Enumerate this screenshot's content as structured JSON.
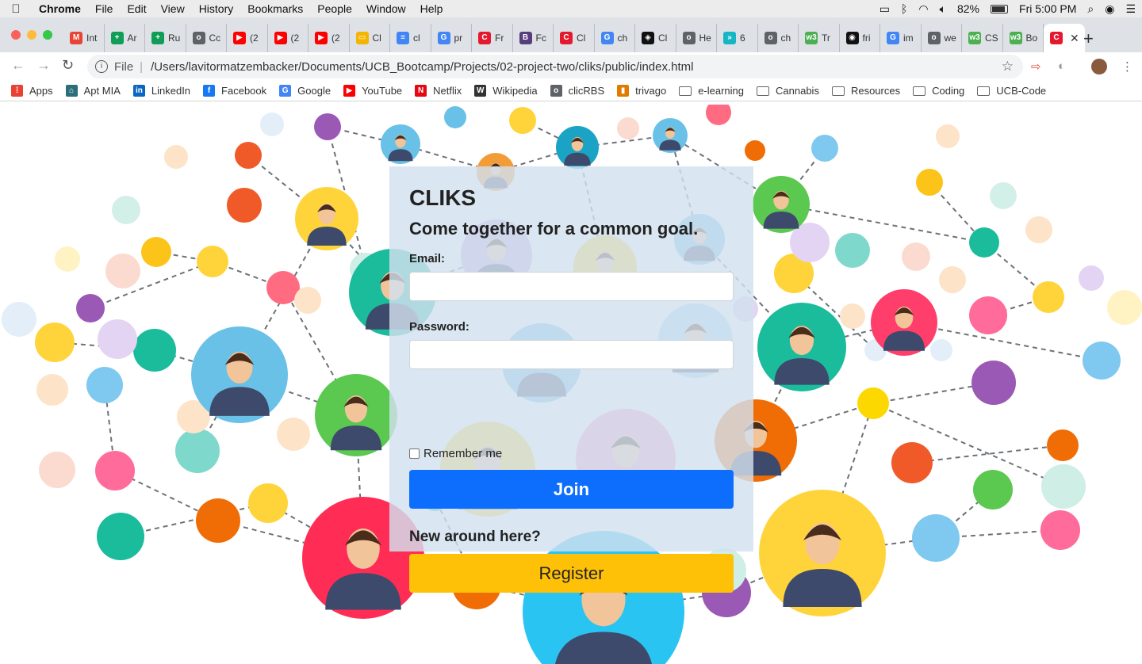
{
  "menubar": {
    "app_name": "Chrome",
    "items": [
      "File",
      "Edit",
      "View",
      "History",
      "Bookmarks",
      "People",
      "Window",
      "Help"
    ],
    "battery": "82%",
    "clock": "Fri 5:00 PM"
  },
  "tabs": [
    {
      "label": "Int",
      "icon": "gmail-icon",
      "color": "#ea4335",
      "glyph": "M"
    },
    {
      "label": "Ar",
      "icon": "sheets-icon",
      "color": "#0f9d58",
      "glyph": "+"
    },
    {
      "label": "Ru",
      "icon": "sheets-icon",
      "color": "#0f9d58",
      "glyph": "+"
    },
    {
      "label": "Cc",
      "icon": "globe-icon",
      "color": "#5f6368",
      "glyph": "o"
    },
    {
      "label": "(2",
      "icon": "youtube-icon",
      "color": "#ff0000",
      "glyph": "▶"
    },
    {
      "label": "(2",
      "icon": "youtube-icon",
      "color": "#ff0000",
      "glyph": "▶"
    },
    {
      "label": "(2",
      "icon": "youtube-icon",
      "color": "#ff0000",
      "glyph": "▶"
    },
    {
      "label": "Cl",
      "icon": "slides-icon",
      "color": "#f4b400",
      "glyph": "▭"
    },
    {
      "label": "cl",
      "icon": "docs-icon",
      "color": "#4285f4",
      "glyph": "≡"
    },
    {
      "label": "pr",
      "icon": "google-icon",
      "color": "#4285f4",
      "glyph": "G"
    },
    {
      "label": "Fr",
      "icon": "cliks-icon",
      "color": "#e5192e",
      "glyph": "C"
    },
    {
      "label": "Fc",
      "icon": "bootstrap-icon",
      "color": "#563d7c",
      "glyph": "B"
    },
    {
      "label": "Cl",
      "icon": "cliks-icon",
      "color": "#e5192e",
      "glyph": "C"
    },
    {
      "label": "ch",
      "icon": "google-icon",
      "color": "#4285f4",
      "glyph": "G"
    },
    {
      "label": "Cl",
      "icon": "codepen-icon",
      "color": "#111111",
      "glyph": "◈"
    },
    {
      "label": "He",
      "icon": "globe-icon",
      "color": "#5f6368",
      "glyph": "o"
    },
    {
      "label": "6",
      "icon": "chevrons-icon",
      "color": "#17b6c4",
      "glyph": "»"
    },
    {
      "label": "ch",
      "icon": "globe-icon",
      "color": "#5f6368",
      "glyph": "o"
    },
    {
      "label": "Tr",
      "icon": "w3schools-icon",
      "color": "#4caf50",
      "glyph": "w3"
    },
    {
      "label": "fri",
      "icon": "github-icon",
      "color": "#111111",
      "glyph": "◉"
    },
    {
      "label": "im",
      "icon": "google-icon",
      "color": "#4285f4",
      "glyph": "G"
    },
    {
      "label": "we",
      "icon": "globe-icon",
      "color": "#5f6368",
      "glyph": "o"
    },
    {
      "label": "CS",
      "icon": "w3schools-icon",
      "color": "#4caf50",
      "glyph": "w3"
    },
    {
      "label": "Bo",
      "icon": "w3schools-icon",
      "color": "#4caf50",
      "glyph": "w3"
    },
    {
      "label": "",
      "icon": "cliks-icon",
      "color": "#e5192e",
      "glyph": "C",
      "active": true
    }
  ],
  "address": {
    "scheme": "File",
    "url": "/Users/lavitormatzembacker/Documents/UCB_Bootcamp/Projects/02-project-two/cliks/public/index.html"
  },
  "bookmarks": [
    {
      "label": "Apps",
      "icon": "apps-grid-icon",
      "color": "#e94235",
      "glyph": "⁞"
    },
    {
      "label": "Apt MIA",
      "icon": "apt-mia-icon",
      "color": "#2a6f7a",
      "glyph": "⌂"
    },
    {
      "label": "LinkedIn",
      "icon": "linkedin-icon",
      "color": "#0a66c2",
      "glyph": "in"
    },
    {
      "label": "Facebook",
      "icon": "facebook-icon",
      "color": "#1877f2",
      "glyph": "f"
    },
    {
      "label": "Google",
      "icon": "google-icon",
      "color": "#4285f4",
      "glyph": "G"
    },
    {
      "label": "YouTube",
      "icon": "youtube-icon",
      "color": "#ff0000",
      "glyph": "▶"
    },
    {
      "label": "Netflix",
      "icon": "netflix-icon",
      "color": "#e50914",
      "glyph": "N"
    },
    {
      "label": "Wikipedia",
      "icon": "wikipedia-icon",
      "color": "#333333",
      "glyph": "W"
    },
    {
      "label": "clicRBS",
      "icon": "globe-icon",
      "color": "#5f6368",
      "glyph": "o"
    },
    {
      "label": "trivago",
      "icon": "trivago-icon",
      "color": "#e07b00",
      "glyph": "▮"
    },
    {
      "label": "e-learning",
      "icon": "folder-icon",
      "folder": true
    },
    {
      "label": "Cannabis",
      "icon": "folder-icon",
      "folder": true
    },
    {
      "label": "Resources",
      "icon": "folder-icon",
      "folder": true
    },
    {
      "label": "Coding",
      "icon": "folder-icon",
      "folder": true
    },
    {
      "label": "UCB-Code",
      "icon": "folder-icon",
      "folder": true
    }
  ],
  "login": {
    "title": "CLIKS",
    "subtitle": "Come together for a common goal.",
    "email_label": "Email:",
    "email_value": "",
    "password_label": "Password:",
    "password_value": "",
    "remember_label": "Remember me",
    "join_label": "Join",
    "new_label": "New around here?",
    "register_label": "Register"
  },
  "colors": {
    "primary": "#0d6efd",
    "warning": "#ffc107",
    "card": "#d2e1ee"
  }
}
